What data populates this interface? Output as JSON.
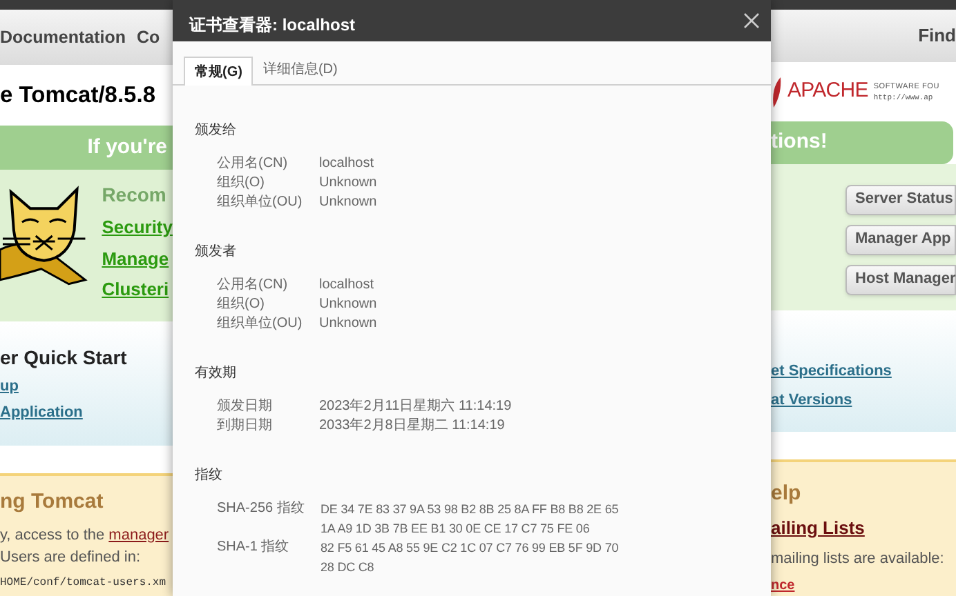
{
  "background_page": {
    "nav_items": [
      "Documentation",
      "Co"
    ],
    "nav_right": "Find",
    "heading": "e Tomcat/8.5.8",
    "banner_left": "If you're",
    "banner_right": "tions!",
    "recommended_heading": "Recom",
    "recommended_links": [
      "Security",
      "Manage",
      "Clusteri"
    ],
    "logo": {
      "name": "APACHE",
      "tagline": "SOFTWARE FOU",
      "url": "http://www.ap"
    },
    "manager_buttons": [
      "Server Status",
      "Manager App",
      "Host Manager"
    ],
    "quick_start_heading": "er Quick Start",
    "quick_start_links_left": [
      "up",
      "Application"
    ],
    "quick_start_links_right": [
      "et Specifications",
      "at Versions"
    ],
    "managing_heading": "ng Tomcat",
    "managing_text": "y, access to the",
    "managing_link": "manager",
    "managing_text_2": "Users are defined in:",
    "managing_code": "HOME/conf/tomcat-users.xm",
    "help_heading": "elp",
    "help_link": "ailing Lists",
    "help_text": "mailing lists are available:",
    "help_sublink": "nce"
  },
  "dialog": {
    "title": "证书查看器: localhost",
    "tabs": [
      {
        "label": "常规(G)",
        "selected": true
      },
      {
        "label": "详细信息(D)",
        "selected": false
      }
    ],
    "sections": [
      {
        "heading": "颁发给",
        "rows": [
          {
            "label": "公用名(CN)",
            "value": "localhost"
          },
          {
            "label": "组织(O)",
            "value": "Unknown"
          },
          {
            "label": "组织单位(OU)",
            "value": "Unknown"
          }
        ]
      },
      {
        "heading": "颁发者",
        "rows": [
          {
            "label": "公用名(CN)",
            "value": "localhost"
          },
          {
            "label": "组织(O)",
            "value": "Unknown"
          },
          {
            "label": "组织单位(OU)",
            "value": "Unknown"
          }
        ]
      },
      {
        "heading": "有效期",
        "rows": [
          {
            "label": "颁发日期",
            "value": "2023年2月11日星期六 11:14:19"
          },
          {
            "label": "到期日期",
            "value": "2033年2月8日星期二 11:14:19"
          }
        ]
      },
      {
        "heading": "指纹",
        "rows": [
          {
            "label": "SHA-256 指纹",
            "value": "DE 34 7E 83 37 9A 53 98 B2 8B 25 8A FF B8 B8 2E 65 1A A9 1D 3B 7B EE B1 30 0E CE 17 C7 75 FE 06"
          },
          {
            "label": "SHA-1 指纹",
            "value": "82 F5 61 45 A8 55 9E C2 1C 07 C7 76 99 EB 5F 9D 70 28 DC C8"
          }
        ]
      }
    ]
  }
}
